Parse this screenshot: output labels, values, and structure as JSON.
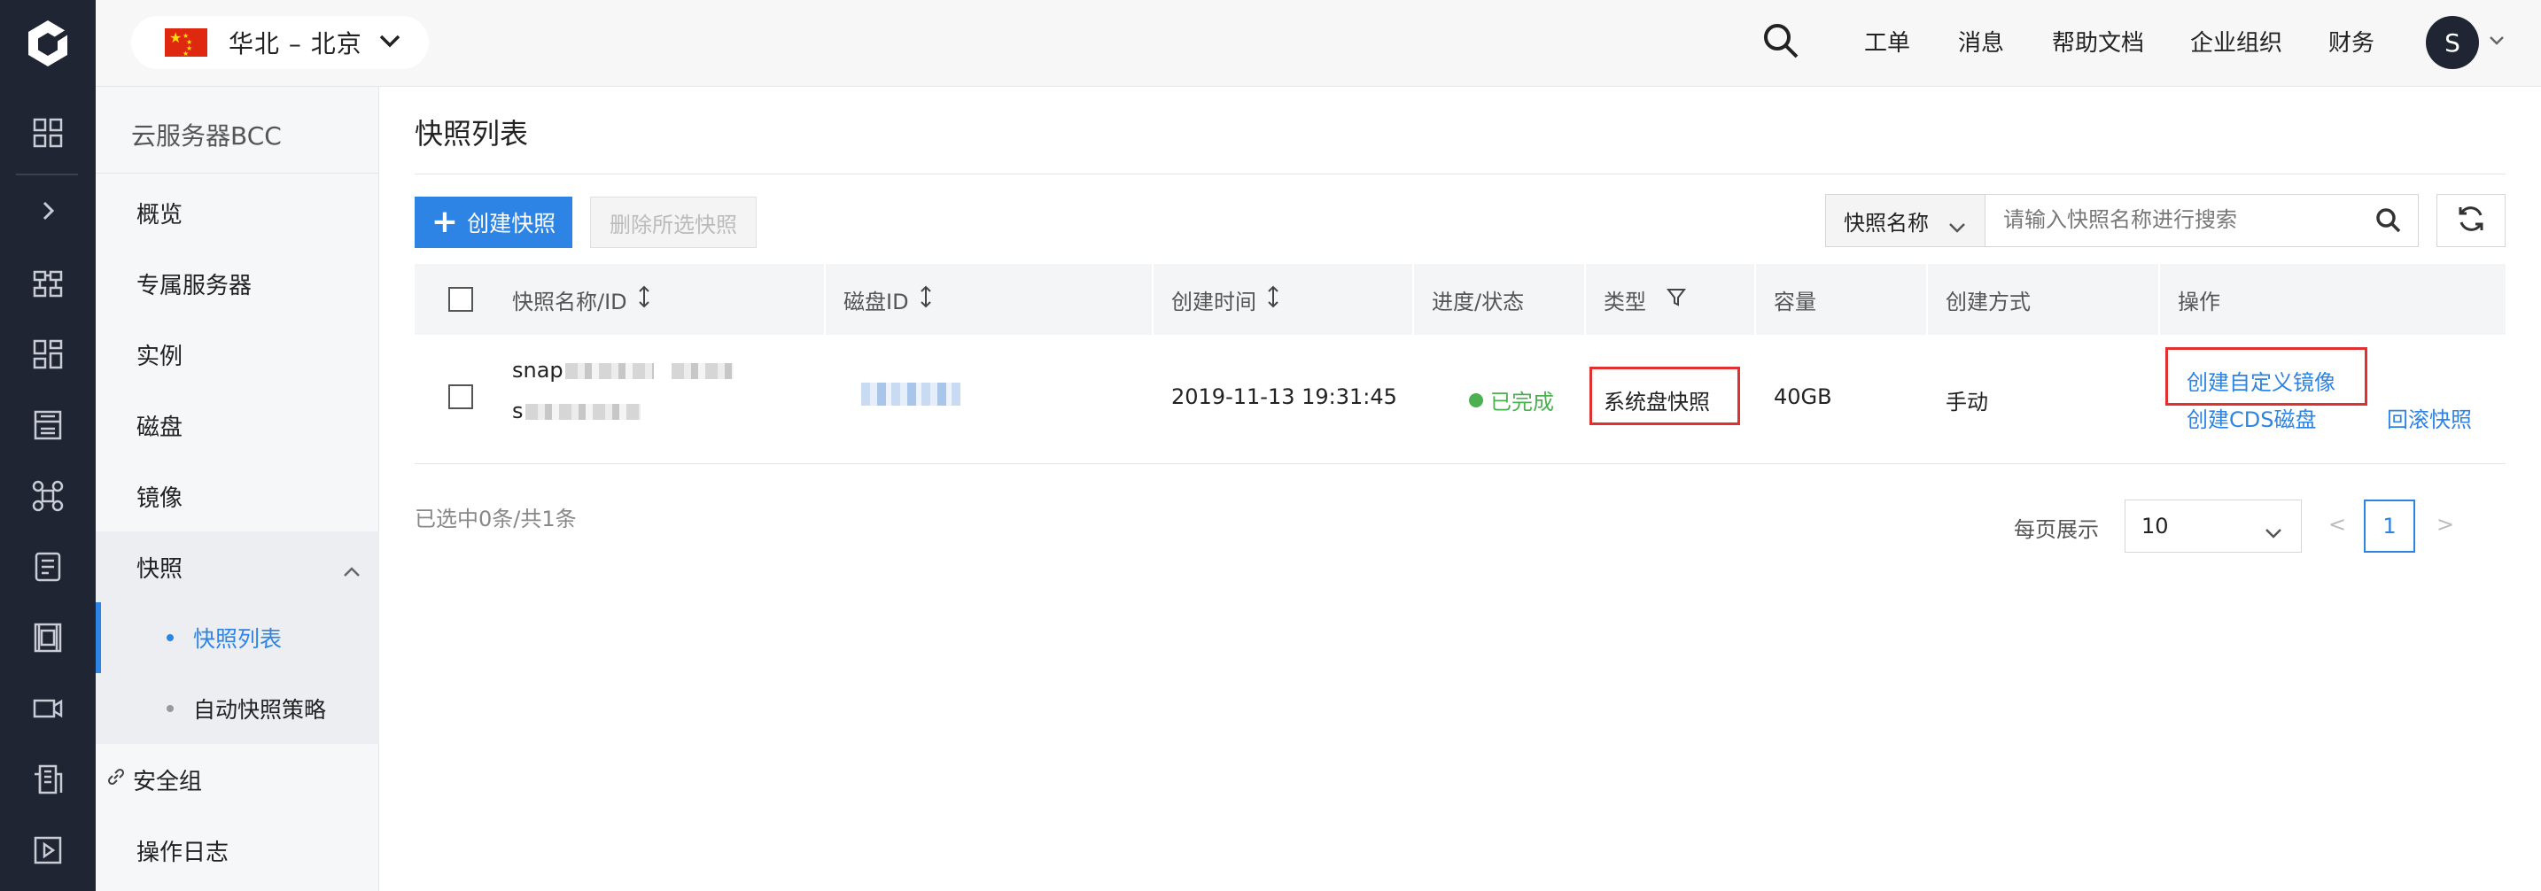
{
  "header": {
    "region_label": "华北 – 北京",
    "links": [
      "工单",
      "消息",
      "帮助文档",
      "企业组织",
      "财务"
    ],
    "avatar_letter": "S"
  },
  "sidebar": {
    "title": "云服务器BCC",
    "items": [
      "概览",
      "专属服务器",
      "实例",
      "磁盘",
      "镜像",
      "快照"
    ],
    "subitems": [
      "快照列表",
      "自动快照策略"
    ],
    "after": [
      "安全组",
      "操作日志"
    ]
  },
  "main": {
    "title": "快照列表",
    "create_button": "创建快照",
    "delete_button": "删除所选快照",
    "search": {
      "field": "快照名称",
      "placeholder": "请输入快照名称进行搜索"
    },
    "columns": [
      "快照名称/ID",
      "磁盘ID",
      "创建时间",
      "进度/状态",
      "类型",
      "容量",
      "创建方式",
      "操作"
    ],
    "rows": [
      {
        "name_prefix": "snap",
        "id_prefix": "s",
        "created": "2019-11-13 19:31:45",
        "status": "已完成",
        "type": "系统盘快照",
        "size": "40GB",
        "method": "手动",
        "actions": [
          "创建自定义镜像",
          "创建CDS磁盘",
          "回滚快照"
        ]
      }
    ],
    "summary": "已选中0条/共1条",
    "pagination": {
      "per_page_label": "每页展示",
      "per_page": "10",
      "prev": "<",
      "next": ">",
      "current_page": "1"
    }
  },
  "colors": {
    "accent": "#2e84e4",
    "rail": "#1f2533",
    "success": "#4caf50",
    "highlight": "#e03030"
  }
}
